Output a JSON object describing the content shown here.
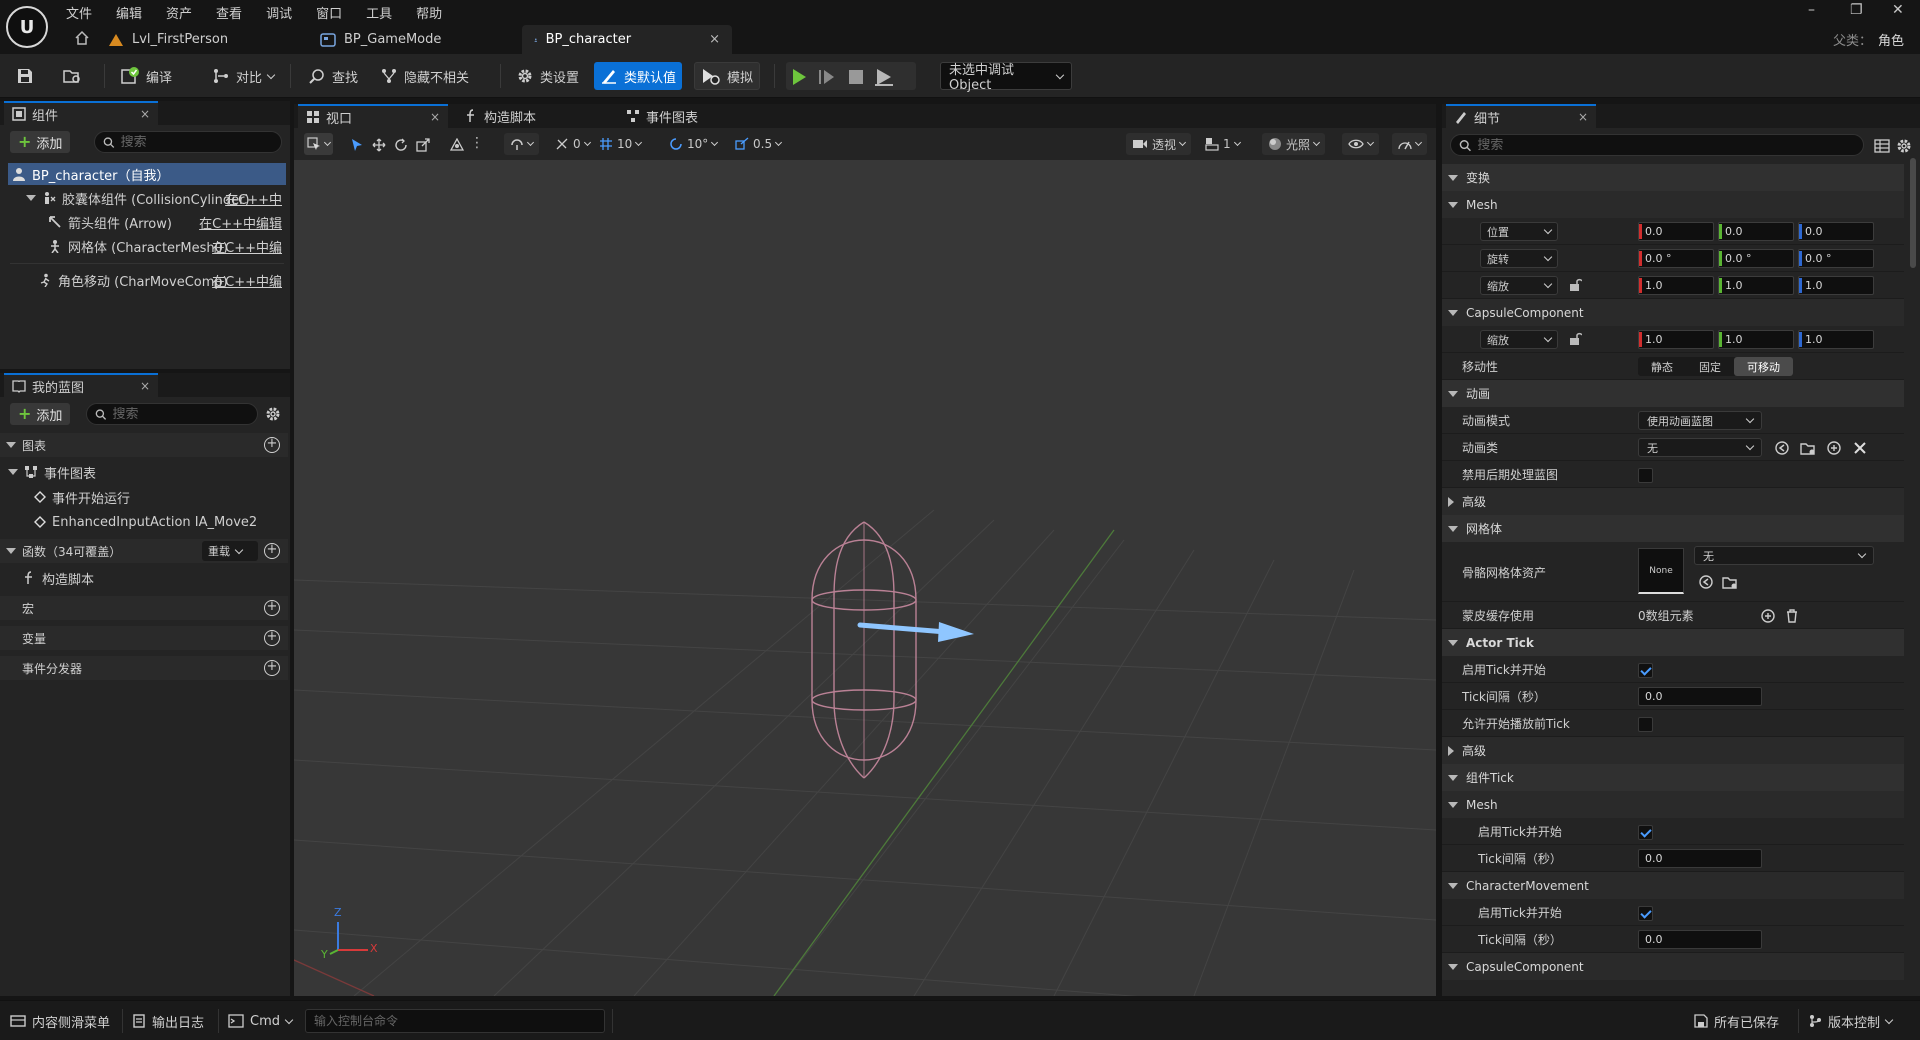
{
  "menu": [
    "文件",
    "编辑",
    "资产",
    "查看",
    "调试",
    "窗口",
    "工具",
    "帮助"
  ],
  "doc_tabs": [
    {
      "label": "Lvl_FirstPerson",
      "icon": "level-icon"
    },
    {
      "label": "BP_GameMode",
      "icon": "blueprint-icon"
    },
    {
      "label": "BP_character",
      "icon": "character-blueprint-icon",
      "close": "×"
    }
  ],
  "window_controls": {
    "minimize": "–",
    "restore": "❐",
    "close": "✕"
  },
  "parent": {
    "label": "父类：",
    "value": "角色"
  },
  "toolbar": {
    "compile": "编译",
    "diff": "对比",
    "find": "查找",
    "hide_unrelated": "隐藏不相关",
    "class_settings": "类设置",
    "class_defaults": "类默认值",
    "simulate": "模拟",
    "debug_object": "未选中调试Object"
  },
  "components_panel": {
    "tab": "组件",
    "close": "×",
    "add": "添加",
    "search_placeholder": "搜索",
    "items": [
      {
        "label": "BP_character（自我）"
      },
      {
        "label": "胶囊体组件 (CollisionCylinder)",
        "link": "在C++中"
      },
      {
        "label": "箭头组件 (Arrow)",
        "link": "在C++中编辑"
      },
      {
        "label": "网格体 (CharacterMesh0)",
        "link": "在C++中编"
      },
      {
        "label": "角色移动 (CharMoveComp)",
        "link": "在C++中编"
      }
    ]
  },
  "my_blueprint": {
    "tab": "我的蓝图",
    "close": "×",
    "add": "添加",
    "search_placeholder": "搜索",
    "sections": {
      "graphs": "图表",
      "event_graph": "事件图表",
      "event_begin": "事件开始运行",
      "enhanced_input": "EnhancedInputAction IA_Move2",
      "functions": "函数（34可覆盖）",
      "override": "重载",
      "construction": "构造脚本",
      "macros": "宏",
      "variables": "变量",
      "dispatchers": "事件分发器"
    }
  },
  "editor_tabs": {
    "viewport": "视口",
    "construction": "构造脚本",
    "event_graph": "事件图表",
    "close": "×"
  },
  "viewport_toolbar": {
    "rot_snap": "0",
    "grid": "10",
    "angle": "10°",
    "scale": "0.5",
    "perspective": "透视",
    "layers": "1",
    "lighting": "光照"
  },
  "axes": {
    "z": "Z",
    "y": "Y",
    "x": "X"
  },
  "details": {
    "tab": "细节",
    "close": "×",
    "search_placeholder": "搜索",
    "transform": "变换",
    "mesh": "Mesh",
    "location": {
      "label": "位置",
      "x": "0.0",
      "y": "0.0",
      "z": "0.0"
    },
    "rotation": {
      "label": "旋转",
      "x": "0.0 °",
      "y": "0.0 °",
      "z": "0.0 °"
    },
    "scale": {
      "label": "缩放",
      "x": "1.0",
      "y": "1.0",
      "z": "1.0"
    },
    "capsule": "CapsuleComponent",
    "capsule_scale": {
      "label": "缩放",
      "x": "1.0",
      "y": "1.0",
      "z": "1.0"
    },
    "mobility": {
      "label": "移动性",
      "options": [
        "静态",
        "固定",
        "可移动"
      ],
      "selected": "可移动"
    },
    "animation": "动画",
    "anim_mode": {
      "label": "动画模式",
      "value": "使用动画蓝图"
    },
    "anim_class": {
      "label": "动画类",
      "value": "无"
    },
    "disable_post": {
      "label": "禁用后期处理蓝图",
      "checked": false
    },
    "advanced": "高级",
    "mesh_section": "网格体",
    "skeletal_mesh": {
      "label": "骨骼网格体资产",
      "thumb": "None",
      "value": "无"
    },
    "skin_cache": {
      "label": "蒙皮缓存使用",
      "value": "0数组元素"
    },
    "actor_tick": "Actor Tick",
    "tick_enable": {
      "label": "启用Tick并开始",
      "checked": true
    },
    "tick_interval": {
      "label": "Tick间隔（秒）",
      "value": "0.0"
    },
    "tick_before_begin": {
      "label": "允许开始播放前Tick",
      "checked": false
    },
    "advanced2": "高级",
    "component_tick": "组件Tick",
    "mesh2": "Mesh",
    "mesh_tick_enable": {
      "label": "启用Tick并开始",
      "checked": true
    },
    "mesh_tick_interval": {
      "label": "Tick间隔（秒）",
      "value": "0.0"
    },
    "char_movement": "CharacterMovement",
    "cm_tick_enable": {
      "label": "启用Tick并开始",
      "checked": true
    },
    "cm_tick_interval": {
      "label": "Tick间隔（秒）",
      "value": "0.0"
    },
    "capsule2": "CapsuleComponent"
  },
  "statusbar": {
    "content_drawer": "内容侧滑菜单",
    "output_log": "输出日志",
    "cmd": "Cmd",
    "cmd_placeholder": "输入控制台命令",
    "saved": "所有已保存",
    "source_control": "版本控制"
  },
  "colors": {
    "accent": "#0a70d6",
    "selected_row": "#3b5a87",
    "play_green": "#6ec53d",
    "arrow_blue": "#8fc6ff",
    "capsule_pink": "#c98aa0"
  }
}
